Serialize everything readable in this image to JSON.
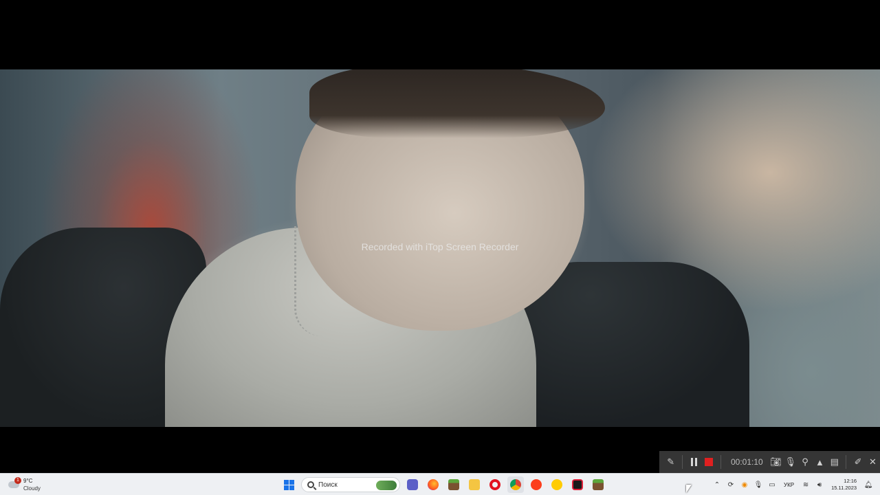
{
  "video": {
    "watermark": "Recorded with iTop Screen Recorder"
  },
  "recorder": {
    "icons": [
      "pen-icon",
      "pause-icon",
      "stop-icon",
      "camera-icon",
      "mic-icon",
      "zoom-icon",
      "volume-icon",
      "comment-icon",
      "edit-icon",
      "close-icon"
    ],
    "elapsed": "00:01:10",
    "stop_color": "#e02020"
  },
  "taskbar": {
    "weather": {
      "badge": "1",
      "temp": "9°C",
      "condition": "Cloudy"
    },
    "search_placeholder": "Поиск",
    "apps": [
      "windows-start",
      "search",
      "meet-icon",
      "firefox-icon",
      "minecraft-icon",
      "file-explorer-icon",
      "opera-icon",
      "chrome-icon",
      "yandex-icon",
      "app-icon",
      "recorder-icon",
      "minecraft-icon"
    ],
    "tray": {
      "language": "УКР",
      "time": "12:16",
      "date": "15.11.2023"
    }
  }
}
